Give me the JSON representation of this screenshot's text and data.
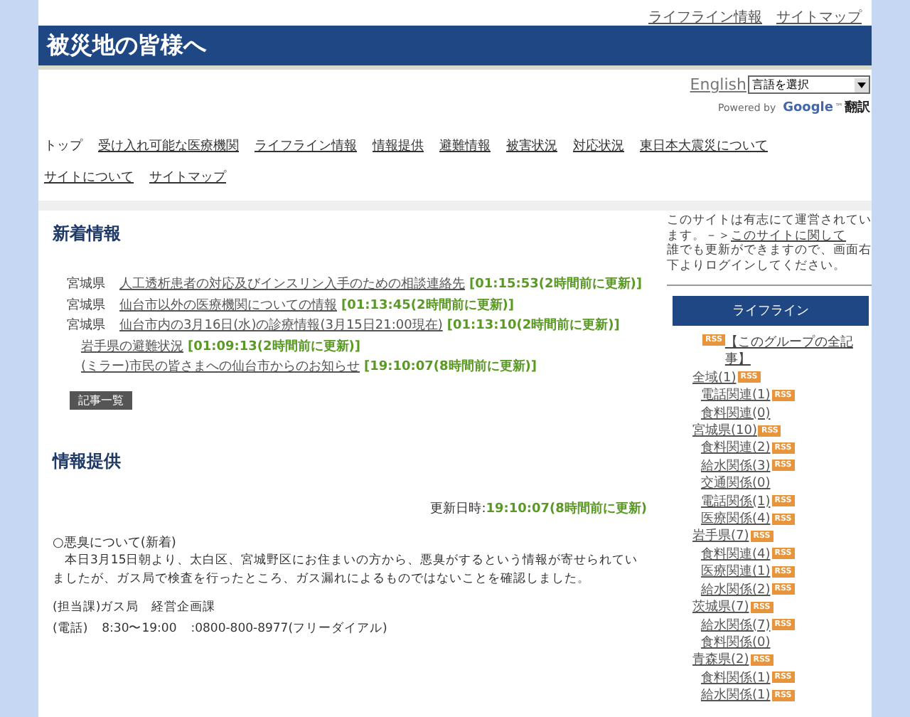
{
  "top_links": [
    "ライフライン情報",
    "サイトマップ"
  ],
  "banner": {
    "title": "被災地の皆様へ"
  },
  "translate": {
    "english": "English",
    "select": "言語を選択",
    "powered": "Powered by",
    "google": "Google",
    "tm": "™",
    "translate": "翻訳"
  },
  "nav": [
    {
      "label": "トップ",
      "selected": true
    },
    {
      "label": "受け入れ可能な医療機関",
      "selected": false
    },
    {
      "label": "ライフライン情報",
      "selected": false
    },
    {
      "label": "情報提供",
      "selected": false
    },
    {
      "label": "避難情報",
      "selected": false
    },
    {
      "label": "被害状況",
      "selected": false
    },
    {
      "label": "対応状況",
      "selected": false
    },
    {
      "label": "東日本大震災について",
      "selected": false
    },
    {
      "label": "サイトについて",
      "selected": false
    },
    {
      "label": "サイトマップ",
      "selected": false
    }
  ],
  "news": {
    "heading": "新着情報",
    "items": [
      {
        "prefecture": "宮城県",
        "title": "人工透析患者の対応及びインスリン入手のための相談連絡先",
        "updated": "[01:15:53(2時間前に更新)]"
      },
      {
        "prefecture": "宮城県",
        "title": "仙台市以外の医療機関についての情報",
        "updated": "[01:13:45(2時間前に更新)]"
      },
      {
        "prefecture": "宮城県",
        "title": "仙台市内の3月16日(水)の診療情報(3月15日21:00現在)",
        "updated": "[01:13:10(2時間前に更新)]"
      },
      {
        "title": "岩手県の避難状況",
        "updated": "[01:09:13(2時間前に更新)]"
      },
      {
        "title": "(ミラー)市民の皆さまへの仙台市からのお知らせ",
        "updated": "[19:10:07(8時間前に更新)]"
      }
    ],
    "list_button": "記事一覧"
  },
  "info": {
    "heading": "情報提供",
    "updated_label": "更新日時:",
    "updated_value": "19:10:07(8時間前に更新)",
    "article_title": "○悪臭について(新着)",
    "body": "本日3月15日朝より、太白区、宮城野区にお住まいの方から、悪臭がするという情報が寄せられていましたが、ガス局で検査を行ったところ、ガス漏れによるものではないことを確認しました。",
    "contact": "(担当課)ガス局　経営企画課",
    "phone_label": "(電話)",
    "phone_hours": "8:30〜19:00",
    "phone_number": ":0800-800-8977(フリーダイアル)"
  },
  "sidebar": {
    "notice_before": "このサイトは有志にて運営されています。－＞",
    "notice_link": "このサイトに関して",
    "notice_after": "誰でも更新ができますので、画面右下よりログインしてください。",
    "box_title": "ライフライン",
    "all_rss": "RSS",
    "all_label": "【このグループの全記事】",
    "tree": [
      {
        "label": "全域(1)",
        "rss": "RSS",
        "children": [
          {
            "label": "電話関連(1)",
            "rss": "RSS"
          },
          {
            "label": "食料関連(0)"
          }
        ]
      },
      {
        "label": "宮城県(10)",
        "rss": "RSS",
        "children": [
          {
            "label": "食料関連(2)",
            "rss": "RSS"
          },
          {
            "label": "給水関係(3)",
            "rss": "RSS"
          },
          {
            "label": "交通関係(0)"
          },
          {
            "label": "電話関係(1)",
            "rss": "RSS"
          },
          {
            "label": "医療関係(4)",
            "rss": "RSS"
          }
        ]
      },
      {
        "label": "岩手県(7)",
        "rss": "RSS",
        "children": [
          {
            "label": "食料関連(4)",
            "rss": "RSS"
          },
          {
            "label": "医療関連(1)",
            "rss": "RSS"
          },
          {
            "label": "給水関係(2)",
            "rss": "RSS"
          }
        ]
      },
      {
        "label": "茨城県(7)",
        "rss": "RSS",
        "children": [
          {
            "label": "給水関係(7)",
            "rss": "RSS"
          },
          {
            "label": "食料関係(0)"
          }
        ]
      },
      {
        "label": "青森県(2)",
        "rss": "RSS",
        "children": [
          {
            "label": "食料関係(1)",
            "rss": "RSS"
          },
          {
            "label": "給水関係(1)",
            "rss": "RSS"
          }
        ]
      }
    ]
  }
}
